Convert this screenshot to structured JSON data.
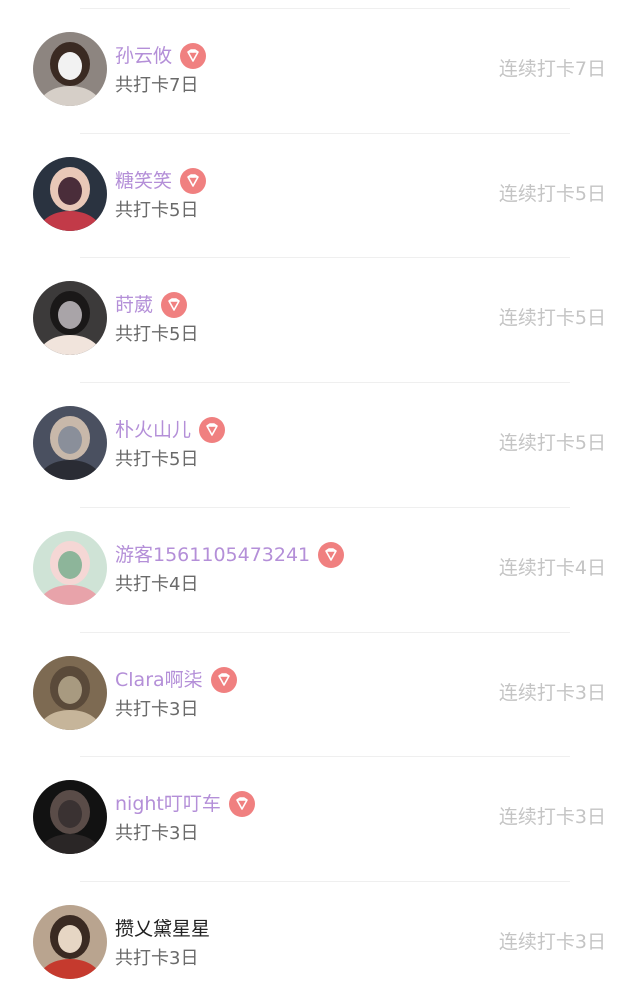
{
  "colors": {
    "vip_name": "#b48fd8",
    "normal_name": "#222222",
    "badge_bg": "#f08080",
    "count_text": "#6a6a6a",
    "streak_text": "#c4c4c4"
  },
  "rows": [
    {
      "name": "孙云攸",
      "vip": true,
      "total": "共打卡7日",
      "streak": "连续打卡7日",
      "avatar_colors": [
        "#8d8580",
        "#d6cfc8",
        "#3a2a22",
        "#f2f2f2"
      ]
    },
    {
      "name": "糖笑笑",
      "vip": true,
      "total": "共打卡5日",
      "streak": "连续打卡5日",
      "avatar_colors": [
        "#2a3340",
        "#c23a48",
        "#e9c8b8",
        "#4a2d3a"
      ]
    },
    {
      "name": "莳葳",
      "vip": true,
      "total": "共打卡5日",
      "streak": "连续打卡5日",
      "avatar_colors": [
        "#3c3a3a",
        "#f1e4dc",
        "#1a1818",
        "#a9a4a8"
      ]
    },
    {
      "name": "朴火山儿",
      "vip": true,
      "total": "共打卡5日",
      "streak": "连续打卡5日",
      "avatar_colors": [
        "#4a5060",
        "#2a2c34",
        "#c8b8aa",
        "#8a8f9a"
      ]
    },
    {
      "name": "游客1561105473241",
      "vip": true,
      "total": "共打卡4日",
      "streak": "连续打卡4日",
      "avatar_colors": [
        "#cfe3d6",
        "#e8a3aa",
        "#f5d7d5",
        "#8db59a"
      ]
    },
    {
      "name": "Clara啊柒",
      "vip": true,
      "total": "共打卡3日",
      "streak": "连续打卡3日",
      "avatar_colors": [
        "#7d6a52",
        "#c6b59a",
        "#5a4a3a",
        "#a89a80"
      ]
    },
    {
      "name": "night叮叮车",
      "vip": true,
      "total": "共打卡3日",
      "streak": "连续打卡3日",
      "avatar_colors": [
        "#121212",
        "#2a2626",
        "#5a4c48",
        "#3a3232"
      ]
    },
    {
      "name": "攒乂黛星星",
      "vip": false,
      "total": "共打卡3日",
      "streak": "连续打卡3日",
      "avatar_colors": [
        "#b9a48f",
        "#c53a2e",
        "#3a2a22",
        "#e6d6c4"
      ]
    }
  ]
}
